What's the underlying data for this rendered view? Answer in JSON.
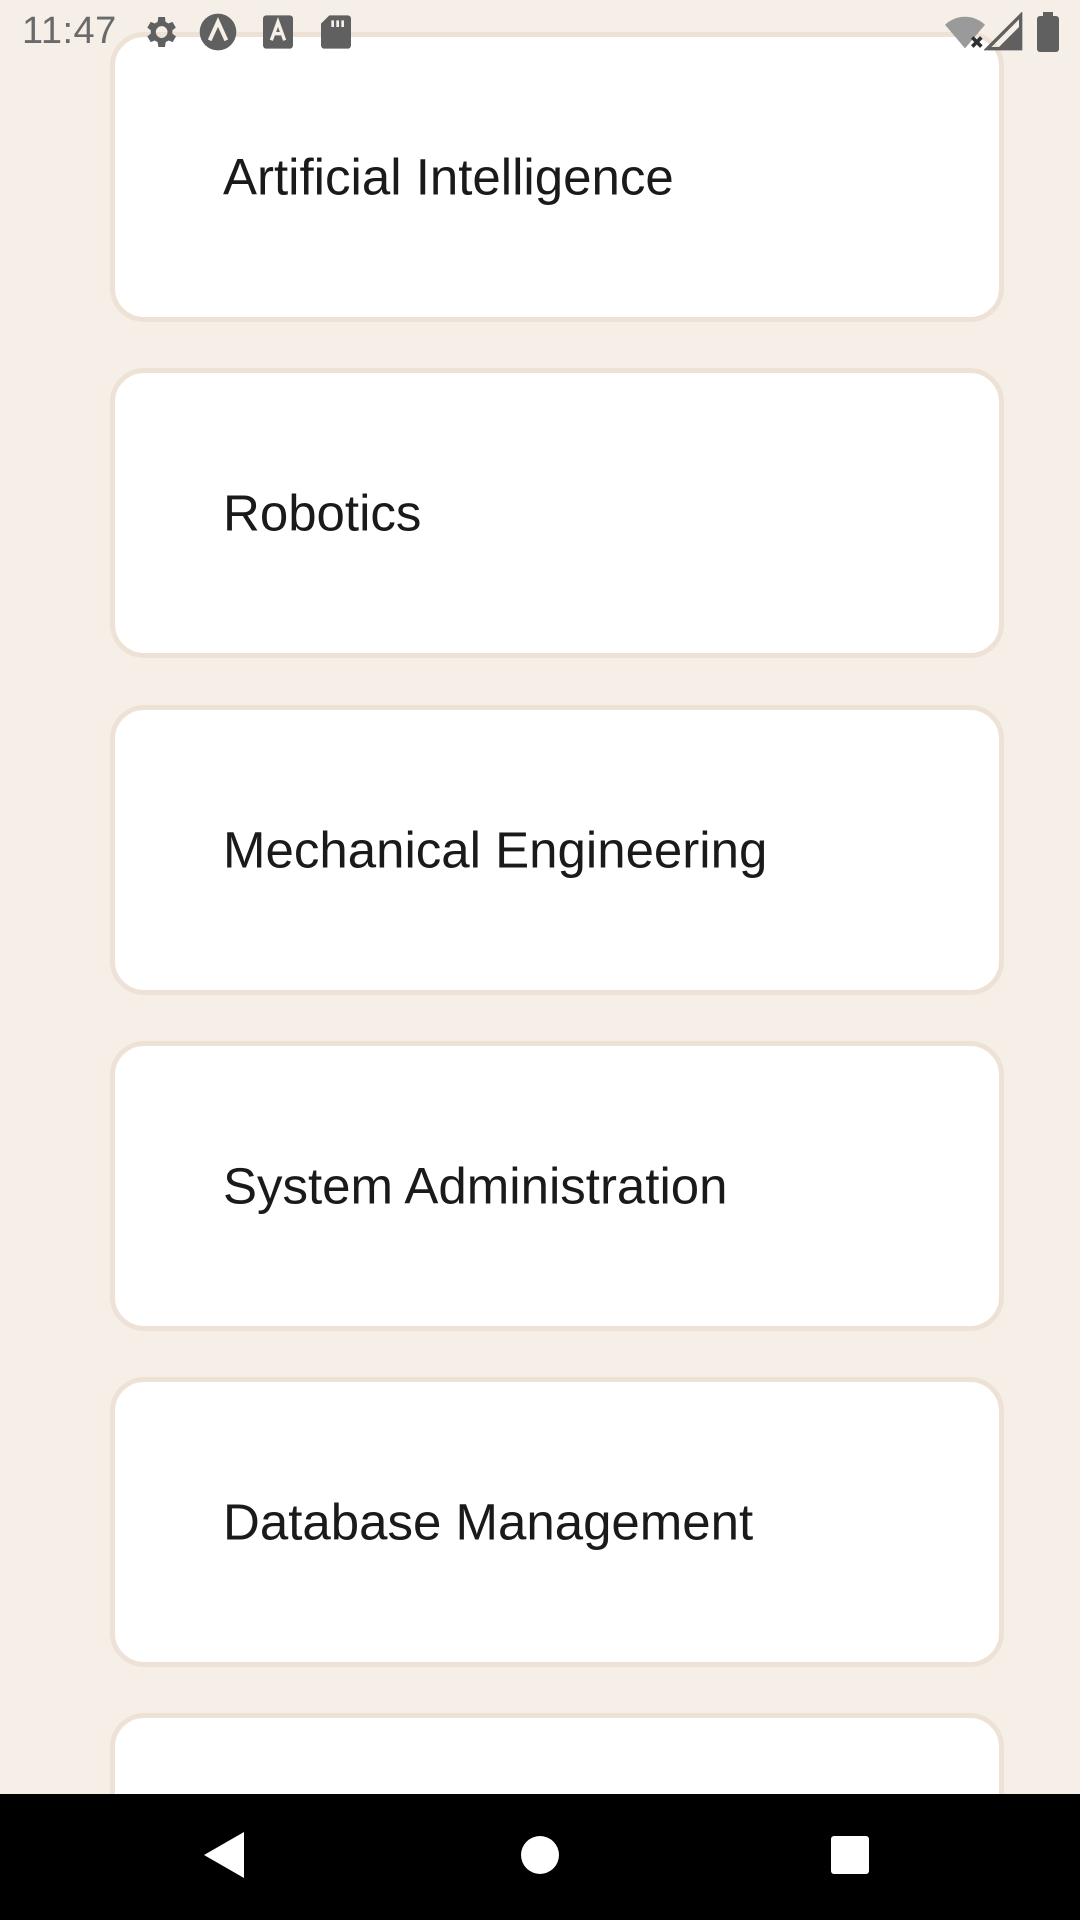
{
  "status_bar": {
    "time": "11:47",
    "left_icons": [
      "gear-icon",
      "vpn-icon",
      "font-icon",
      "sd-card-icon"
    ],
    "right_icons": [
      "wifi-off-icon",
      "signal-icon",
      "battery-icon"
    ]
  },
  "list": {
    "items": [
      {
        "label": "Artificial Intelligence"
      },
      {
        "label": "Robotics"
      },
      {
        "label": "Mechanical Engineering"
      },
      {
        "label": "System Administration"
      },
      {
        "label": "Database Management"
      },
      {
        "label": ""
      }
    ]
  },
  "nav_bar": {
    "buttons": [
      "back-icon",
      "home-icon",
      "recents-icon"
    ]
  },
  "colors": {
    "background": "#F6EFE8",
    "card": "#FFFFFF",
    "card_border": "#EEE2D6",
    "text": "#1A1A1A",
    "nav_bar": "#000000"
  }
}
